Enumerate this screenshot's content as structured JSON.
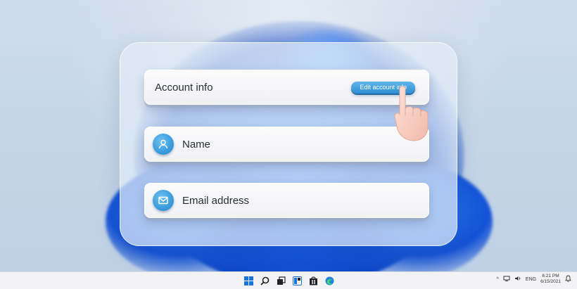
{
  "card": {
    "account_title": "Account info",
    "edit_button": "Edit account info",
    "name_label": "Name",
    "email_label": "Email address"
  },
  "taskbar": {
    "icons": [
      "windows-start-icon",
      "search-icon",
      "task-view-icon",
      "widgets-icon",
      "store-icon",
      "edge-browser-icon"
    ],
    "tray": {
      "chevron": "^",
      "language": "ENG",
      "time": "6:21 PM",
      "date": "6/15/2021"
    }
  },
  "colors": {
    "accent": "#3b9bdc",
    "button": "#2f8fd3",
    "bloom": "#1558e0"
  }
}
